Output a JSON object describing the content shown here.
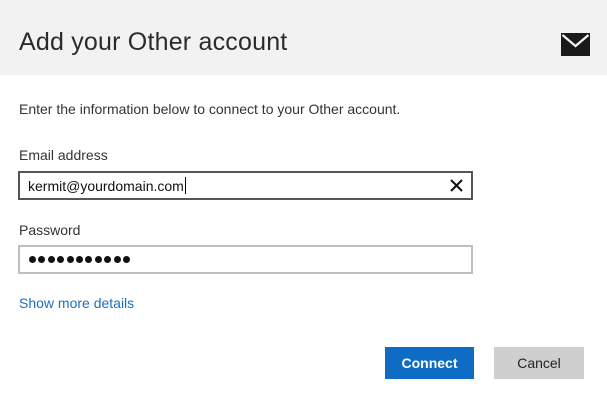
{
  "dialog": {
    "title": "Add your Other account",
    "header_icon": "mail-envelope-icon",
    "intro": "Enter the information below to connect to your Other account.",
    "email": {
      "label": "Email address",
      "value": "kermit@yourdomain.com",
      "clear_icon": "close-x-icon"
    },
    "password": {
      "label": "Password",
      "masked_length": 11
    },
    "more_details_link": "Show more details",
    "connect_label": "Connect",
    "cancel_label": "Cancel"
  },
  "colors": {
    "header_bg": "#f2f2f2",
    "accent": "#0f6cc4",
    "link": "#1e6dc0",
    "cancel_bg": "#cfcfcf"
  }
}
